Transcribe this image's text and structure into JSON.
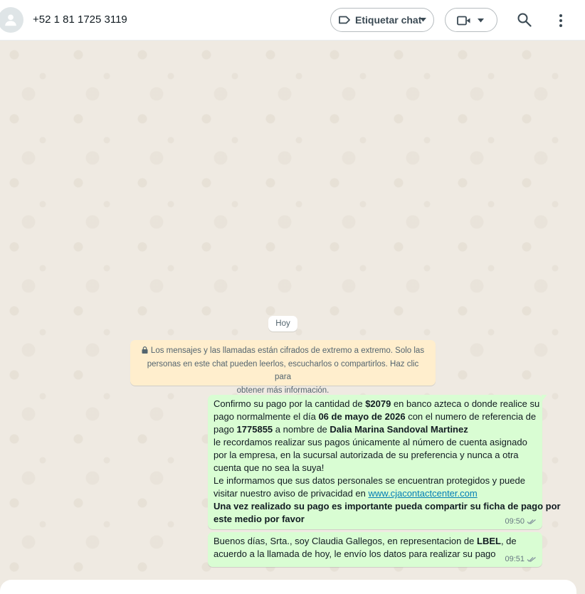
{
  "header": {
    "contact_name": "+52 1 81 1725 3119",
    "label_button": "Etiquetar chat"
  },
  "chat": {
    "date_chip": "Hoy",
    "encryption_notice": {
      "line1": "Los mensajes y las llamadas están cifrados de extremo a extremo. Solo las",
      "line2": "personas en este chat pueden leerlos, escucharlos o compartirlos. Haz clic para",
      "line3": "obtener más información."
    },
    "messages": [
      {
        "l1_a": "Confirmo su pago por la cantidad de ",
        "l1_b": "$2079",
        "l1_c": "  en banco azteca o donde realice su",
        "l2_a": "pago normalmente el día ",
        "l2_b": "06 de mayo de 2026",
        "l2_c": " con el numero de referencia de",
        "l3_a": "pago ",
        "l3_b": "1775855",
        "l3_c": " a nombre de ",
        "l3_d": "Dalia Marina Sandoval Martinez",
        "l4": " le recordamos realizar sus pagos únicamente al número de cuenta asignado",
        "l5": "por la empresa, en la sucursal autorizada de su preferencia y nunca a otra",
        "l6": "cuenta que no sea la suya!",
        "l7": " Le informamos que sus datos personales se encuentran protegidos y puede",
        "l8_a": "visitar nuestro aviso de privacidad en ",
        "l8_link": "www.cjacontactcenter.com",
        "l9": "Una vez realizado su pago es importante pueda compartir su ficha de pago por",
        "l10": "este medio por favor",
        "time": "09:50"
      },
      {
        "l1_a": "Buenos días, Srta.,  soy Claudia Gallegos, en representacion de ",
        "l1_b": "LBEL",
        "l1_c": ",  de",
        "l2": "acuerdo a la llamada de hoy, le envío los datos para realizar su pago",
        "time": "09:51"
      }
    ]
  },
  "colors": {
    "outgoing_bubble": "#d9fdd3",
    "notice_bg": "#ffeecd",
    "chat_bg": "#efeae2",
    "read_ticks": "#8696a0"
  }
}
